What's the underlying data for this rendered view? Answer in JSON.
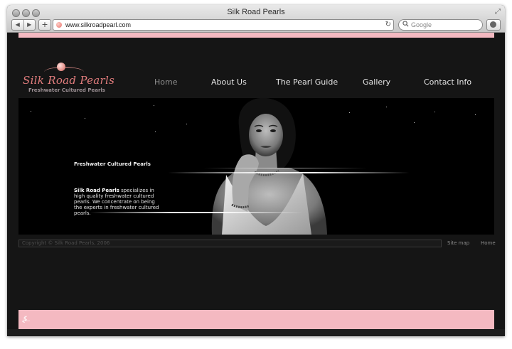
{
  "window": {
    "title": "Silk Road Pearls"
  },
  "toolbar": {
    "back_label": "◀",
    "forward_label": "▶",
    "add_label": "+",
    "url": "www.silkroadpearl.com",
    "reload_label": "↻",
    "search_placeholder": "Google",
    "search_icon": "magnifier-icon",
    "fullscreen_icon": "⤢"
  },
  "site": {
    "logo_title": "Silk Road Pearls",
    "logo_subtitle": "Freshwater Cultured Pearls",
    "nav": [
      {
        "label": "Home",
        "active": true
      },
      {
        "label": "About Us",
        "active": false
      },
      {
        "label": "The Pearl Guide",
        "active": false
      },
      {
        "label": "Gallery",
        "active": false
      },
      {
        "label": "Contact Info",
        "active": false
      }
    ],
    "hero": {
      "heading": "Freshwater Cultured Pearls",
      "brand": "Silk Road Pearls",
      "body": " specializes in high quality freshwater cultured pearls. We concentrate on being the experts in freshwater cultured pearls."
    },
    "footer": {
      "copyright": "Copyright © Silk Road Pearls, 2006",
      "links": [
        "Site map",
        "Home"
      ]
    },
    "bottom_glyph": "⍼"
  },
  "colors": {
    "pink_band": "#f4b9c1",
    "logo_text": "#e27d7d",
    "page_bg": "#151515",
    "nav_active": "#8f8f8f"
  }
}
